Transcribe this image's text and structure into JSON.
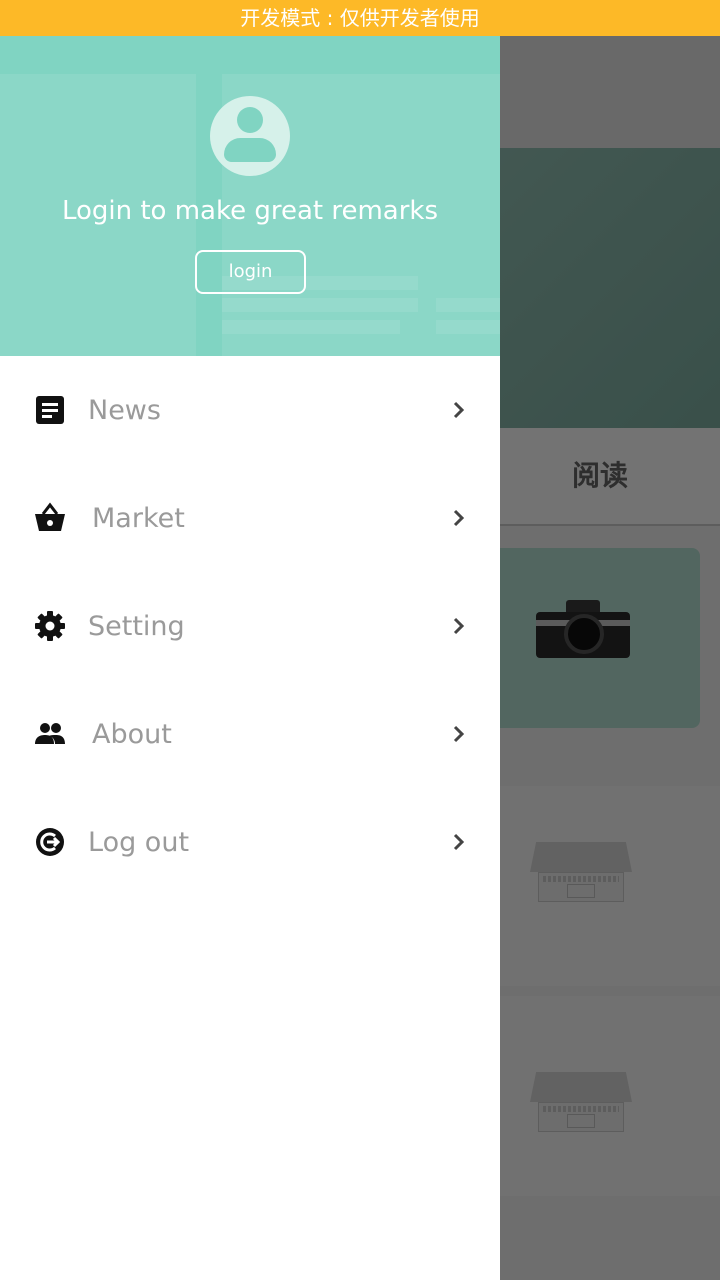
{
  "dev_banner": {
    "text": "开发模式 : 仅供开发者使用",
    "color": "#FDB927"
  },
  "background": {
    "tab_label": "阅读"
  },
  "drawer": {
    "header": {
      "title": "Login to make great remarks",
      "login_label": "login",
      "color": "#80D4C2"
    },
    "menu": [
      {
        "label": "News",
        "icon": "article-icon"
      },
      {
        "label": "Market",
        "icon": "basket-icon"
      },
      {
        "label": "Setting",
        "icon": "gear-icon"
      },
      {
        "label": "About",
        "icon": "people-icon"
      },
      {
        "label": "Log out",
        "icon": "logout-icon"
      }
    ]
  }
}
